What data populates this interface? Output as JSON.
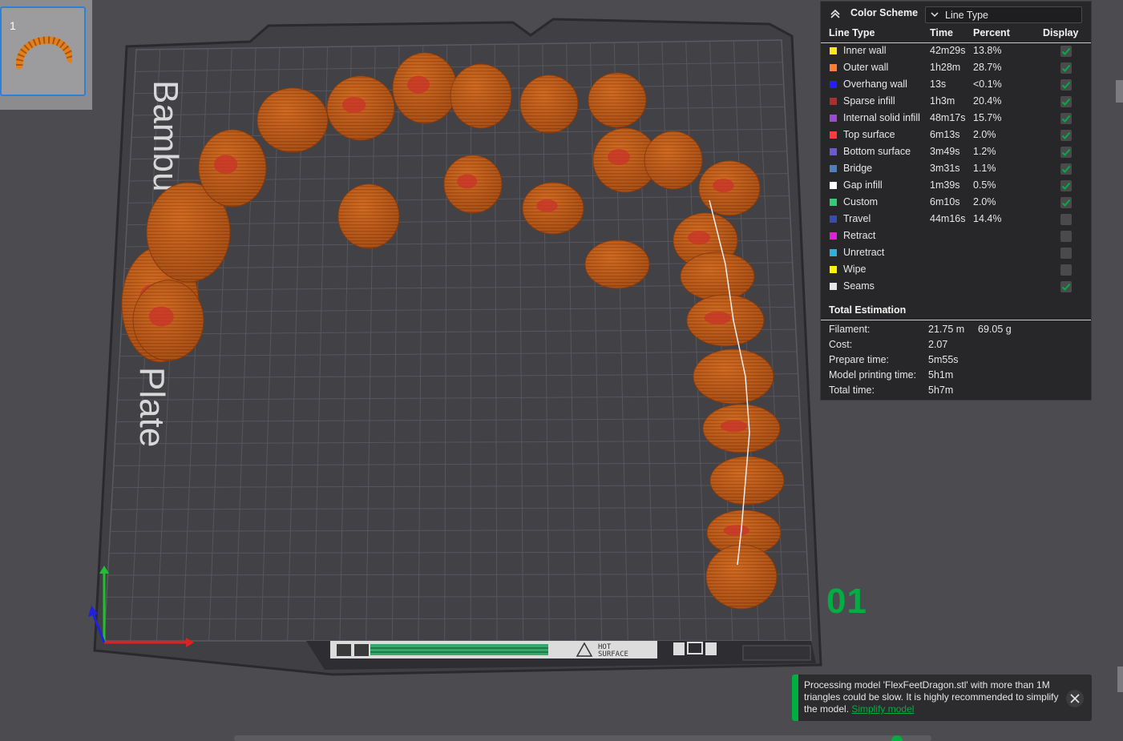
{
  "thumbnail": {
    "index_label": "1"
  },
  "plate": {
    "label_text": "Bambu Plate",
    "label_word1": "Bambu",
    "label_word2": "Plate",
    "plate_number": "01",
    "hot_surface_label_line1": "HOT",
    "hot_surface_label_line2": "SURFACE"
  },
  "color_scheme": {
    "title": "Color Scheme",
    "selected": "Line Type",
    "headers": {
      "type": "Line Type",
      "time": "Time",
      "percent": "Percent",
      "display": "Display"
    },
    "rows": [
      {
        "name": "Inner wall",
        "time": "42m29s",
        "percent": "13.8%",
        "color": "#ffe617",
        "display": true
      },
      {
        "name": "Outer wall",
        "time": "1h28m",
        "percent": "28.7%",
        "color": "#ff7d38",
        "display": true
      },
      {
        "name": "Overhang wall",
        "time": "13s",
        "percent": "<0.1%",
        "color": "#1f1fff",
        "display": true
      },
      {
        "name": "Sparse infill",
        "time": "1h3m",
        "percent": "20.4%",
        "color": "#b22c2c",
        "display": true
      },
      {
        "name": "Internal solid infill",
        "time": "48m17s",
        "percent": "15.7%",
        "color": "#9a4bd1",
        "display": true
      },
      {
        "name": "Top surface",
        "time": "6m13s",
        "percent": "2.0%",
        "color": "#ff3b3b",
        "display": true
      },
      {
        "name": "Bottom surface",
        "time": "3m49s",
        "percent": "1.2%",
        "color": "#6a5acd",
        "display": true
      },
      {
        "name": "Bridge",
        "time": "3m31s",
        "percent": "1.1%",
        "color": "#4d80ba",
        "display": true
      },
      {
        "name": "Gap infill",
        "time": "1m39s",
        "percent": "0.5%",
        "color": "#ffffff",
        "display": true
      },
      {
        "name": "Custom",
        "time": "6m10s",
        "percent": "2.0%",
        "color": "#36cc77",
        "display": true
      },
      {
        "name": "Travel",
        "time": "44m16s",
        "percent": "14.4%",
        "color": "#3a4bb0",
        "display": false
      },
      {
        "name": "Retract",
        "time": "",
        "percent": "",
        "color": "#e61ed7",
        "display": false
      },
      {
        "name": "Unretract",
        "time": "",
        "percent": "",
        "color": "#2fb2d8",
        "display": false
      },
      {
        "name": "Wipe",
        "time": "",
        "percent": "",
        "color": "#fff200",
        "display": false
      },
      {
        "name": "Seams",
        "time": "",
        "percent": "",
        "color": "#e6e6e6",
        "display": true
      }
    ],
    "total_title": "Total Estimation",
    "estimates": [
      {
        "label": "Filament:",
        "value": "21.75 m",
        "value2": "69.05 g"
      },
      {
        "label": "Cost:",
        "value": "2.07",
        "value2": ""
      },
      {
        "label": "Prepare time:",
        "value": "5m55s",
        "value2": ""
      },
      {
        "label": "Model printing time:",
        "value": "5h1m",
        "value2": ""
      },
      {
        "label": "Total time:",
        "value": "5h7m",
        "value2": ""
      }
    ]
  },
  "notification": {
    "message": "Processing model 'FlexFeetDragon.stl' with more than 1M triangles could be slow. It is highly recommended to simplify the model.",
    "link": "Simplify model"
  },
  "colors": {
    "model": "#c9641c",
    "accent_green": "#00ae42",
    "plate": "#414146",
    "grid": "#5a5a60"
  }
}
